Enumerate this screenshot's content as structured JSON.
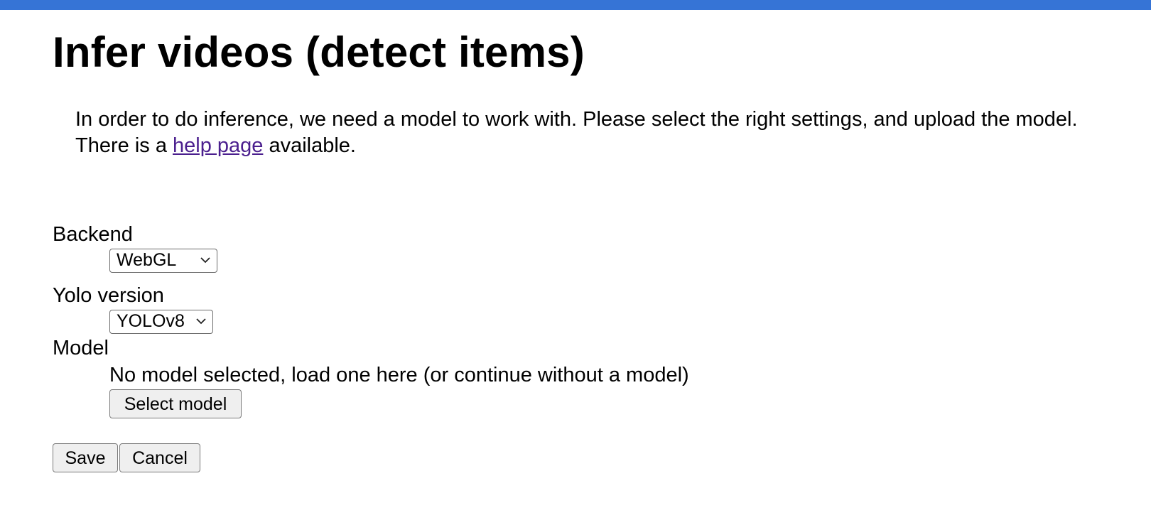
{
  "page": {
    "title": "Infer videos (detect items)",
    "intro_before_link": "In order to do inference, we need a model to work with. Please select the right settings, and upload the model. There is a ",
    "help_link_label": "help page",
    "intro_after_link": " available."
  },
  "colors": {
    "top_bar": "#3674d6",
    "link": "#4b1f8e"
  },
  "form": {
    "backend": {
      "label": "Backend",
      "selected": "WebGL"
    },
    "yolo_version": {
      "label": "Yolo version",
      "selected": "YOLOv8"
    },
    "model": {
      "label": "Model",
      "status": "No model selected, load one here (or continue without a model)",
      "select_button_label": "Select model"
    }
  },
  "actions": {
    "save_label": "Save",
    "cancel_label": "Cancel"
  },
  "icons": {
    "select_arrow": "chevron-down-icon"
  }
}
